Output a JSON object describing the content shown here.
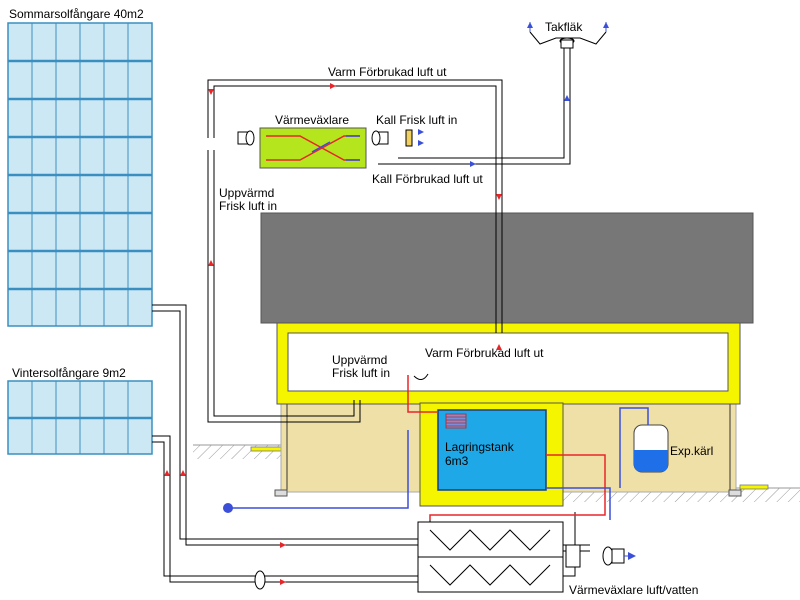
{
  "labels": {
    "summer_collector": "Sommarsolfångare 40m2",
    "winter_collector": "Vintersolfångare 9m2",
    "roof_fan": "Takfläk",
    "warm_exhaust_top": "Varm Förbrukad luft ut",
    "hrv": "Värmeväxlare",
    "cold_fresh_in": "Kall Frisk luft in",
    "cold_exhaust_out": "Kall Förbrukad luft ut",
    "heated_fresh_line1": "Uppvärmd",
    "heated_fresh_line2": "Frisk luft in",
    "inside_heated_line1": "Uppvärmd",
    "inside_heated_line2": "Frisk luft in",
    "warm_exhaust_inside": "Varm Förbrukad luft ut",
    "tank_line1": "Lagringstank",
    "tank_line2": "6m3",
    "exp_vessel": "Exp.kärl",
    "air_water_hx": "Värmeväxlare luft/vatten"
  },
  "colors": {
    "warm_air": "#e8262a",
    "cold_air": "#3b4fd8",
    "roof": "#777777",
    "house_frame": "#f5f500",
    "house_wall": "#efe0a8",
    "tank": "#1ea8e8",
    "hrv": "#b5e61d",
    "panel": "#cde8f5",
    "panel_grid": "#3a8fc0"
  }
}
